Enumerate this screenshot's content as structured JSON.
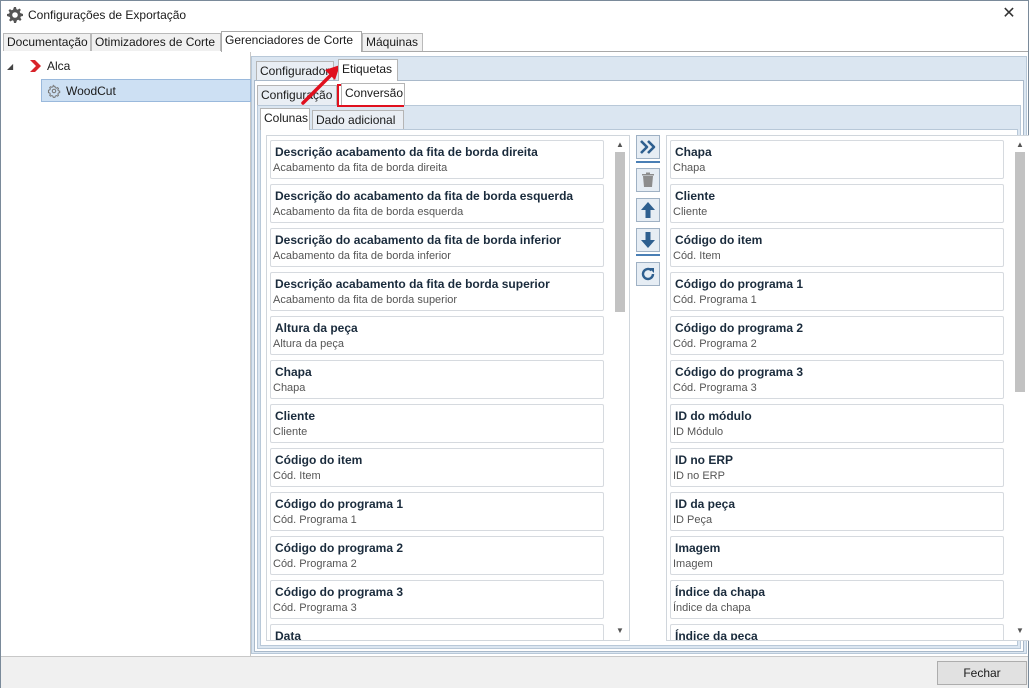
{
  "window": {
    "title": "Configurações de Exportação",
    "close_glyph": "✕"
  },
  "main_tabs": [
    "Documentação",
    "Otimizadores de Corte",
    "Gerenciadores de Corte",
    "Máquinas"
  ],
  "tree": {
    "root": "Alca",
    "child": "WoodCut"
  },
  "sub_tabs_1": [
    "Configurador",
    "Etiquetas"
  ],
  "sub_tabs_2": [
    "Configuração",
    "Conversão"
  ],
  "sub_tabs_3": [
    "Colunas",
    "Dado adicional"
  ],
  "available_columns": [
    {
      "title": "Descrição acabamento da fita de borda direita",
      "subtitle": "Acabamento da fita de borda direita"
    },
    {
      "title": "Descrição do acabamento da fita de borda esquerda",
      "subtitle": "Acabamento da fita de borda esquerda"
    },
    {
      "title": "Descrição do acabamento da fita de borda inferior",
      "subtitle": "Acabamento da fita de borda inferior"
    },
    {
      "title": "Descrição acabamento da fita de borda superior",
      "subtitle": "Acabamento da fita de borda superior"
    },
    {
      "title": "Altura da peça",
      "subtitle": "Altura da peça"
    },
    {
      "title": "Chapa",
      "subtitle": "Chapa"
    },
    {
      "title": "Cliente",
      "subtitle": "Cliente"
    },
    {
      "title": "Código do item",
      "subtitle": "Cód. Item"
    },
    {
      "title": "Código do programa 1",
      "subtitle": "Cód. Programa 1"
    },
    {
      "title": "Código do programa 2",
      "subtitle": "Cód. Programa 2"
    },
    {
      "title": "Código do programa 3",
      "subtitle": "Cód. Programa 3"
    },
    {
      "title": "Data",
      "subtitle": ""
    }
  ],
  "selected_columns": [
    {
      "title": "Chapa",
      "subtitle": "Chapa"
    },
    {
      "title": "Cliente",
      "subtitle": "Cliente"
    },
    {
      "title": "Código do item",
      "subtitle": "Cód. Item"
    },
    {
      "title": "Código do programa 1",
      "subtitle": "Cód. Programa 1"
    },
    {
      "title": "Código do programa 2",
      "subtitle": "Cód. Programa 2"
    },
    {
      "title": "Código do programa 3",
      "subtitle": "Cód. Programa 3"
    },
    {
      "title": "ID do módulo",
      "subtitle": "ID Módulo"
    },
    {
      "title": "ID no ERP",
      "subtitle": "ID no ERP"
    },
    {
      "title": "ID da peça",
      "subtitle": "ID Peça"
    },
    {
      "title": "Imagem",
      "subtitle": "Imagem"
    },
    {
      "title": "Índice da chapa",
      "subtitle": "Índice da chapa"
    },
    {
      "title": "Índice da peça",
      "subtitle": ""
    }
  ],
  "toolbar_icons": [
    "move-all-right-icon",
    "delete-icon",
    "move-up-icon",
    "move-down-icon",
    "refresh-icon"
  ],
  "footer": {
    "close_label": "Fechar"
  },
  "colors": {
    "accent": "#2e5f8f",
    "highlight_red": "#e0101e",
    "panel_bg": "#dbe6f1",
    "selection_bg": "#cde0f3"
  }
}
